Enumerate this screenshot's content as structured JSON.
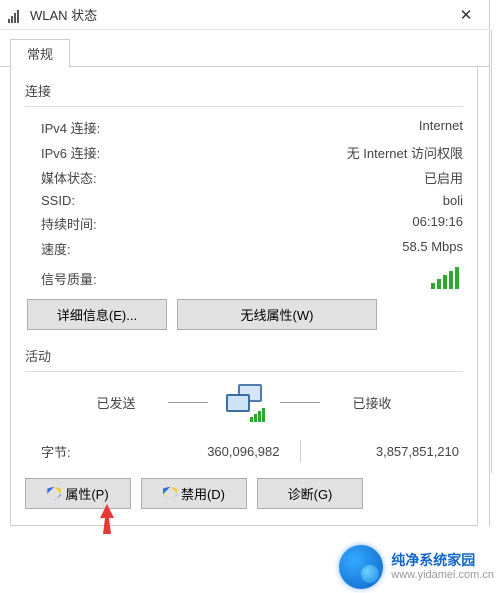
{
  "window": {
    "title": "WLAN 状态"
  },
  "tabs": {
    "general": "常规"
  },
  "connection": {
    "section_title": "连接",
    "rows": {
      "ipv4_label": "IPv4 连接:",
      "ipv4_value": "Internet",
      "ipv6_label": "IPv6 连接:",
      "ipv6_value": "无 Internet 访问权限",
      "media_label": "媒体状态:",
      "media_value": "已启用",
      "ssid_label": "SSID:",
      "ssid_value": "boli",
      "duration_label": "持续时间:",
      "duration_value": "06:19:16",
      "speed_label": "速度:",
      "speed_value": "58.5 Mbps",
      "signal_label": "信号质量:"
    },
    "buttons": {
      "details": "详细信息(E)...",
      "wireless_props": "无线属性(W)"
    }
  },
  "activity": {
    "section_title": "活动",
    "sent_label": "已发送",
    "received_label": "已接收",
    "bytes_label": "字节:",
    "bytes_sent": "360,096,982",
    "bytes_received": "3,857,851,210",
    "buttons": {
      "properties": "属性(P)",
      "disable": "禁用(D)",
      "diagnose": "诊断(G)"
    }
  },
  "watermark": {
    "name": "纯净系统家园",
    "url": "www.yidamei.com.cn"
  }
}
